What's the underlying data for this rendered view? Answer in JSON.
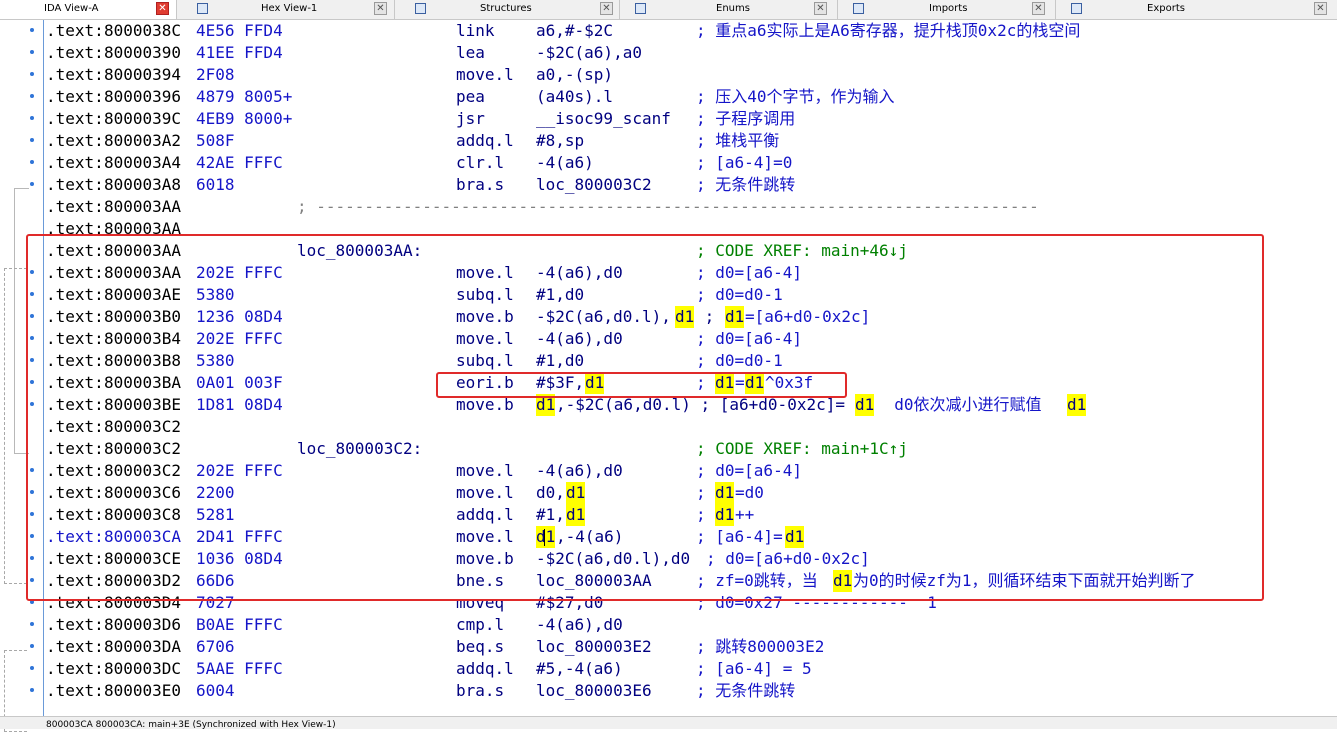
{
  "tabs": [
    {
      "label": "IDA View-A",
      "icon": "disassembly-icon",
      "active": true
    },
    {
      "label": "Hex View-1",
      "icon": "hex-view-icon",
      "active": false
    },
    {
      "label": "Structures",
      "icon": "structures-icon",
      "active": false
    },
    {
      "label": "Enums",
      "icon": "enums-icon",
      "active": false
    },
    {
      "label": "Imports",
      "icon": "imports-icon",
      "active": false
    },
    {
      "label": "Exports",
      "icon": "exports-icon",
      "active": false
    }
  ],
  "listing": {
    "r0": {
      "seg": ".text:",
      "addr": "8000038C",
      "bytes": "4E56 FFD4",
      "mnem": "link",
      "ops": "a6,#-$2C",
      "cmt": "; 重点a6实际上是A6寄存器，提升栈顶0x2c的栈空间"
    },
    "r1": {
      "seg": ".text:",
      "addr": "80000390",
      "bytes": "41EE FFD4",
      "mnem": "lea",
      "ops": "-$2C(a6),a0",
      "cmt": ""
    },
    "r2": {
      "seg": ".text:",
      "addr": "80000394",
      "bytes": "2F08",
      "mnem": "move.l",
      "ops": "a0,-(sp)",
      "cmt": ""
    },
    "r3": {
      "seg": ".text:",
      "addr": "80000396",
      "bytes": "4879 8005+",
      "mnem": "pea",
      "ops": "(a40s).l",
      "cmt": "; 压入40个字节，作为输入"
    },
    "r4": {
      "seg": ".text:",
      "addr": "8000039C",
      "bytes": "4EB9 8000+",
      "mnem": "jsr",
      "ops": "__isoc99_scanf",
      "cmt": "; 子程序调用"
    },
    "r5": {
      "seg": ".text:",
      "addr": "800003A2",
      "bytes": "508F",
      "mnem": "addq.l",
      "ops": "#8,sp",
      "cmt": "; 堆栈平衡"
    },
    "r6": {
      "seg": ".text:",
      "addr": "800003A4",
      "bytes": "42AE FFFC",
      "mnem": "clr.l",
      "ops": "-4(a6)",
      "cmt": "; [a6-4]=0"
    },
    "r7": {
      "seg": ".text:",
      "addr": "800003A8",
      "bytes": "6018",
      "mnem": "bra.s",
      "ops": "loc_800003C2",
      "cmt": "; 无条件跳转"
    },
    "r8": {
      "seg": ".text:",
      "addr": "800003AA",
      "sep": "; ---------------------------------------------------------------------------"
    },
    "r9": {
      "seg": ".text:",
      "addr": "800003AA"
    },
    "r10": {
      "seg": ".text:",
      "addr": "800003AA",
      "label": "loc_800003AA:",
      "xref": "; CODE XREF: main+46↓j"
    },
    "r11": {
      "seg": ".text:",
      "addr": "800003AA",
      "bytes": "202E FFFC",
      "mnem": "move.l",
      "ops": "-4(a6),d0",
      "cmt": "; d0=[a6-4]"
    },
    "r12": {
      "seg": ".text:",
      "addr": "800003AE",
      "bytes": "5380",
      "mnem": "subq.l",
      "ops": "#1,d0",
      "cmt": "; d0=d0-1"
    },
    "r13": {
      "seg": ".text:",
      "addr": "800003B0",
      "bytes": "1236 08D4",
      "mnem": "move.b",
      "ops_a": "-$2C(a6,d0.l),",
      "hl": "d1",
      "ops_c": " ;",
      "cmt_a": " ",
      "cmt_b": "=[a6+d0-0x2c]"
    },
    "r14": {
      "seg": ".text:",
      "addr": "800003B4",
      "bytes": "202E FFFC",
      "mnem": "move.l",
      "ops": "-4(a6),d0",
      "cmt": "; d0=[a6-4]"
    },
    "r15": {
      "seg": ".text:",
      "addr": "800003B8",
      "bytes": "5380",
      "mnem": "subq.l",
      "ops": "#1,d0",
      "cmt": "; d0=d0-1"
    },
    "r16": {
      "seg": ".text:",
      "addr": "800003BA",
      "bytes": "0A01 003F",
      "mnem": "eori.b",
      "ops_a": "#$3F,",
      "hl": "d1",
      "cmt_a": "; ",
      "cmt_b": "=",
      "cmt_c": "^0x3f"
    },
    "r17": {
      "seg": ".text:",
      "addr": "800003BE",
      "bytes": "1D81 08D4",
      "mnem": "move.b",
      "hl": "d1",
      "ops_b": ",-$2C(a6,d0.l) ; [a6+d0-0x2c]=",
      "cmt_b": "  d0依次减小进行赋值"
    },
    "r18": {
      "seg": ".text:",
      "addr": "800003C2"
    },
    "r19": {
      "seg": ".text:",
      "addr": "800003C2",
      "label": "loc_800003C2:",
      "xref": "; CODE XREF: main+1C↑j"
    },
    "r20": {
      "seg": ".text:",
      "addr": "800003C2",
      "bytes": "202E FFFC",
      "mnem": "move.l",
      "ops": "-4(a6),d0",
      "cmt": "; d0=[a6-4]"
    },
    "r21": {
      "seg": ".text:",
      "addr": "800003C6",
      "bytes": "2200",
      "mnem": "move.l",
      "ops_a": "d0,",
      "hl": "d1",
      "cmt_a": "; ",
      "cmt_b": "=d0"
    },
    "r22": {
      "seg": ".text:",
      "addr": "800003C8",
      "bytes": "5281",
      "mnem": "addq.l",
      "ops_a": "#1,",
      "hl": "d1",
      "cmt_a": "; ",
      "cmt_b": "++"
    },
    "r23": {
      "seg": ".text:",
      "addr": "800003CA",
      "bytes": "2D41 FFFC",
      "mnem": "move.l",
      "hl": "d1",
      "ops_b": ",-4(a6)",
      "cmt_a": "; [a6-4]="
    },
    "r24": {
      "seg": ".text:",
      "addr": "800003CE",
      "bytes": "1036 08D4",
      "mnem": "move.b",
      "ops": "-$2C(a6,d0.l),d0",
      "cmt": "; d0=[a6+d0-0x2c]"
    },
    "r25": {
      "seg": ".text:",
      "addr": "800003D2",
      "bytes": "66D6",
      "mnem": "bne.s",
      "ops": "loc_800003AA",
      "cmt_a": "; zf=0跳转，当",
      "hl": "d1",
      "cmt_b": "为0的时候zf为1，则循环结束下面就开始判断了"
    },
    "r26": {
      "seg": ".text:",
      "addr": "800003D4",
      "bytes": "7027",
      "mnem": "moveq",
      "ops": "#$27,d0",
      "cmt": "; d0=0x27 ------------  1"
    },
    "r27": {
      "seg": ".text:",
      "addr": "800003D6",
      "bytes": "B0AE FFFC",
      "mnem": "cmp.l",
      "ops": "-4(a6),d0",
      "cmt": ""
    },
    "r28": {
      "seg": ".text:",
      "addr": "800003DA",
      "bytes": "6706",
      "mnem": "beq.s",
      "ops": "loc_800003E2",
      "cmt": "; 跳转800003E2"
    },
    "r29": {
      "seg": ".text:",
      "addr": "800003DC",
      "bytes": "5AAE FFFC",
      "mnem": "addq.l",
      "ops": "#5,-4(a6)",
      "cmt": "; [a6-4] = 5"
    },
    "r30": {
      "seg": ".text:",
      "addr": "800003E0",
      "bytes": "6004",
      "mnem": "bra.s",
      "ops": "loc_800003E6",
      "cmt": "; 无条件跳转"
    }
  },
  "status_bar": {
    "text": "800003CA 800003CA: main+3E (Synchronized with Hex View-1)"
  }
}
